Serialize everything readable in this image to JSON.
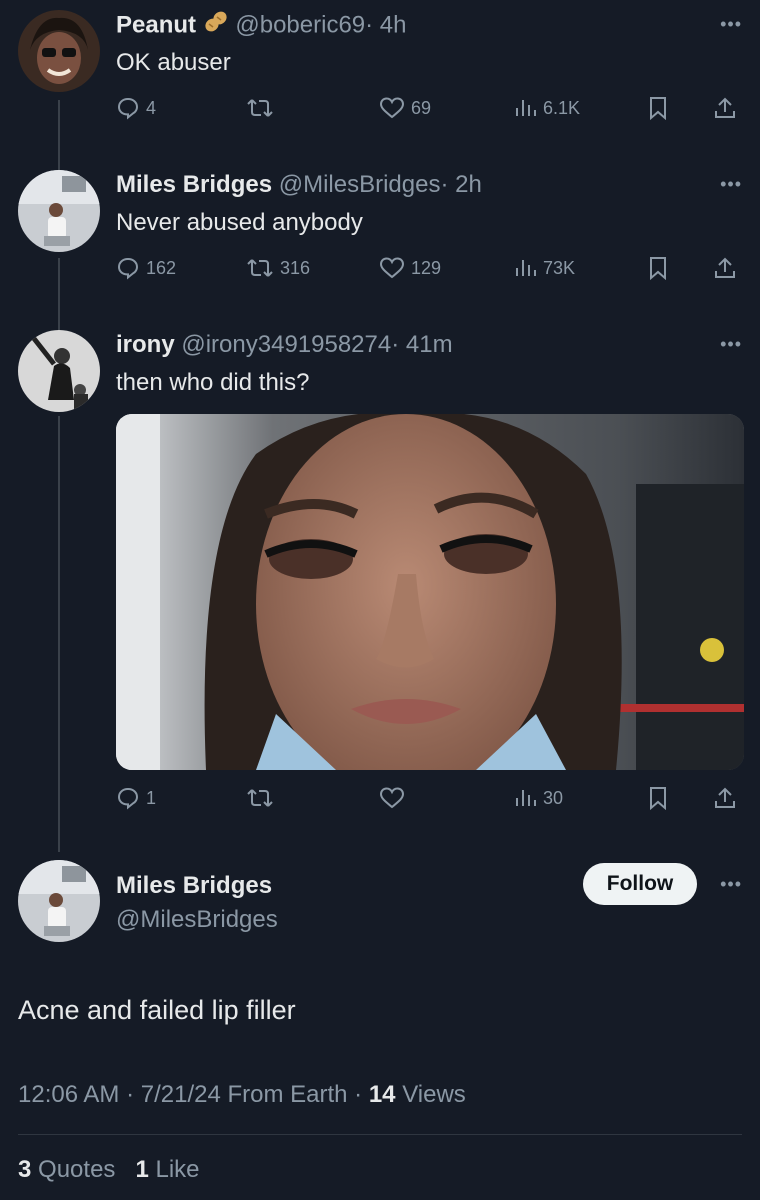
{
  "tweets": [
    {
      "name": "Peanut",
      "handle": "@boberic69",
      "time": "· 4h",
      "text": "OK abuser",
      "replies": "4",
      "retweets": "",
      "likes": "69",
      "views": "6.1K"
    },
    {
      "name": "Miles Bridges",
      "handle": "@MilesBridges",
      "time": "· 2h",
      "text": "Never abused anybody",
      "replies": "162",
      "retweets": "316",
      "likes": "129",
      "views": "73K"
    },
    {
      "name": "irony",
      "handle": "@irony3491958274",
      "time": "· 41m",
      "text": "then who did this?",
      "replies": "1",
      "retweets": "",
      "likes": "",
      "views": "30"
    }
  ],
  "main": {
    "name": "Miles Bridges",
    "handle": "@MilesBridges",
    "follow_label": "Follow",
    "text": "Acne and failed lip filler",
    "timestamp": "12:06 AM · 7/21/24 From Earth ·",
    "views_count": "14",
    "views_label": "Views",
    "quotes_count": "3",
    "quotes_label": "Quotes",
    "likes_count": "1",
    "likes_label": "Like"
  },
  "colors": {
    "background": "#151b26",
    "text": "#e7e9ea",
    "muted": "#8b98a5",
    "button": "#eff3f4"
  }
}
